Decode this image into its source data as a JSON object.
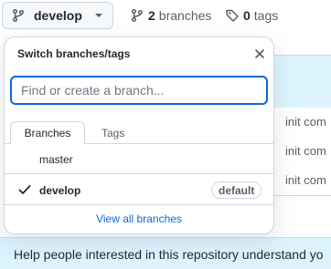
{
  "topbar": {
    "branch_button": {
      "label": "develop",
      "icon": "git-branch-icon",
      "caret": "chevron-down-icon"
    },
    "branches_stat": {
      "count": "2",
      "label": "branches",
      "icon": "git-branch-icon"
    },
    "tags_stat": {
      "count": "0",
      "label": "tags",
      "icon": "tag-icon"
    }
  },
  "dropdown": {
    "title": "Switch branches/tags",
    "close_icon": "close-icon",
    "search": {
      "placeholder": "Find or create a branch...",
      "value": ""
    },
    "tabs": [
      {
        "label": "Branches",
        "active": true
      },
      {
        "label": "Tags",
        "active": false
      }
    ],
    "items": [
      {
        "name": "master",
        "selected": false,
        "badge": ""
      },
      {
        "name": "develop",
        "selected": true,
        "badge": "default"
      }
    ],
    "footer_link": "View all branches"
  },
  "background": {
    "commit_rows": [
      "init com",
      "init com",
      "init com"
    ],
    "help_banner": "Help people interested in this repository understand yo"
  },
  "colors": {
    "accent": "#0969da",
    "border": "#d0d7de",
    "banner_bg": "#ddf4ff",
    "muted_text": "#57606a"
  }
}
